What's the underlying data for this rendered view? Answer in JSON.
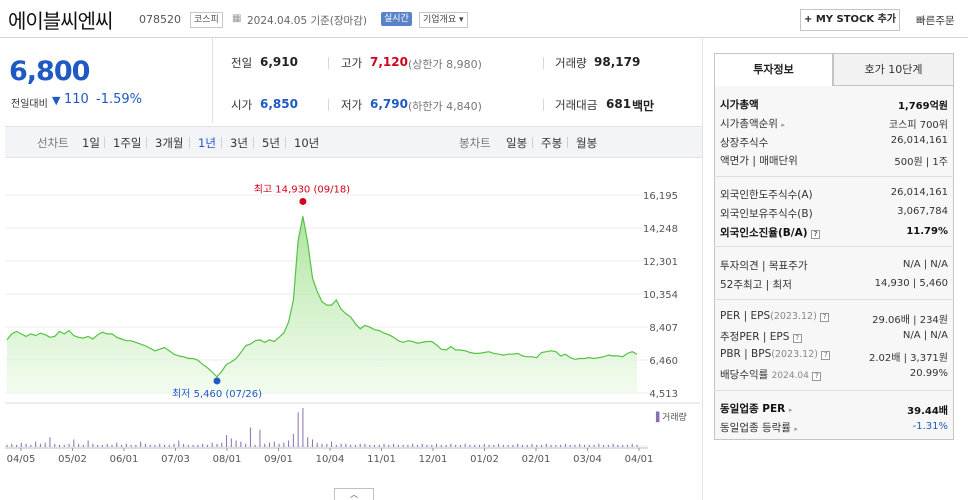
{
  "header": {
    "company": "에이블씨엔씨",
    "code": "078520",
    "market": "코스피",
    "asof": "2024.04.05  기준(장마감)",
    "realtime": "실시간",
    "overview": "기업개요",
    "mystock": "+ MY STOCK 추가",
    "quick_order": "빠른주문"
  },
  "price": {
    "current": "6,800",
    "change_label": "전일대비",
    "change_value": "110",
    "change_pct": "-1.59%",
    "direction": "down"
  },
  "quote": {
    "prev_label": "전일",
    "prev": "6,910",
    "high_label": "고가",
    "high": "7,120",
    "upper_limit": "(상한가 8,980)",
    "volume_label": "거래량",
    "volume": "98,179",
    "open_label": "시가",
    "open": "6,850",
    "low_label": "저가",
    "low": "6,790",
    "lower_limit": "(하한가 4,840)",
    "amount_label": "거래대금",
    "amount": "681",
    "amount_unit": "백만"
  },
  "periods": {
    "line_label": "선차트",
    "line": [
      "1일",
      "1주일",
      "3개월",
      "1년",
      "3년",
      "5년",
      "10년"
    ],
    "selected": "1년",
    "candle_label": "봉차트",
    "candle": [
      "일봉",
      "주봉",
      "월봉"
    ]
  },
  "chart_data": {
    "type": "area",
    "y_ticks": [
      "16,195",
      "14,248",
      "12,301",
      "10,354",
      "8,407",
      "6,460",
      "4,513"
    ],
    "ylim": [
      4513,
      16195
    ],
    "x_ticks": [
      "04/05",
      "05/02",
      "06/01",
      "07/03",
      "08/01",
      "09/01",
      "10/04",
      "11/01",
      "12/01",
      "01/02",
      "02/01",
      "03/04",
      "04/01"
    ],
    "high_label": "최고 14,930 (09/18)",
    "low_label": "최저 5,460 (07/26)",
    "high": 14930,
    "low": 5460,
    "volume_label": "거래량",
    "series": [
      {
        "values": [
          7650,
          8000,
          8150,
          8000,
          7850,
          8000,
          7900,
          8050,
          7950,
          7800,
          7850,
          8150,
          8000,
          8200,
          7900,
          7800,
          7750,
          7850,
          7700,
          7950,
          8100,
          8000,
          8000,
          7800,
          7700,
          7600,
          7600,
          7500,
          7400,
          7300,
          7150,
          7000,
          7100,
          7200,
          7000,
          6800,
          6700,
          6650,
          6550,
          6550,
          6450,
          6200,
          6000,
          5750,
          5460,
          5800,
          6200,
          6350,
          6550,
          6900,
          7300,
          7400,
          7600,
          7650,
          7500,
          7650,
          7550,
          7800,
          8050,
          8700,
          10000,
          13500,
          14930,
          13400,
          11300,
          10500,
          9900,
          9700,
          9700,
          10000,
          9450,
          9200,
          9000,
          8600,
          8300,
          8500,
          8400,
          8250,
          8200,
          8050,
          7950,
          7800,
          7600,
          7500,
          7600,
          7550,
          7450,
          7500,
          7550,
          7550,
          7350,
          7100,
          7050,
          7250,
          7050,
          7050,
          7000,
          6900,
          6850,
          6850,
          6900,
          6950,
          6850,
          6800,
          6750,
          6800,
          6800,
          6850,
          6700,
          6650,
          6650,
          6600,
          6900,
          6950,
          7000,
          6950,
          6700,
          6800,
          6600,
          6500,
          6550,
          6550,
          6600,
          6550,
          6600,
          6650,
          6750,
          6700,
          6700,
          6650,
          6850,
          6950,
          6800
        ]
      }
    ],
    "volume": [
      2,
      3,
      2,
      4,
      3,
      2,
      5,
      3,
      4,
      9,
      3,
      2,
      2,
      3,
      7,
      3,
      2,
      6,
      3,
      2,
      2,
      3,
      2,
      4,
      2,
      3,
      2,
      2,
      5,
      3,
      2,
      2,
      3,
      2,
      2,
      3,
      6,
      3,
      2,
      2,
      2,
      3,
      2,
      4,
      3,
      4,
      11,
      8,
      6,
      5,
      3,
      18,
      2,
      16,
      3,
      4,
      5,
      3,
      4,
      6,
      12,
      32,
      36,
      9,
      7,
      4,
      3,
      3,
      5,
      2,
      3,
      3,
      2,
      2,
      3,
      3,
      2,
      2,
      2,
      3,
      2,
      3,
      2,
      2,
      2,
      3,
      2,
      3,
      2,
      2,
      3,
      2,
      2,
      3,
      2,
      2,
      3,
      2,
      2,
      2,
      3,
      2,
      2,
      3,
      2,
      2,
      2,
      3,
      2,
      2,
      3,
      2,
      2,
      3,
      2,
      2,
      2,
      3,
      2,
      2,
      3,
      2,
      2,
      2,
      3,
      2,
      2,
      3,
      2,
      2,
      2,
      3,
      2
    ]
  },
  "invest": {
    "tab_active": "투자정보",
    "tab_other": "호가 10단계",
    "rows1": [
      {
        "label": "시가총액",
        "value": "1,769억원",
        "bold": true
      },
      {
        "label": "시가총액순위",
        "value": "코스피 700위"
      },
      {
        "label": "상장주식수",
        "value": "26,014,161"
      },
      {
        "label": "액면가 | 매매단위",
        "value": "500원 | 1주"
      }
    ],
    "rows2": [
      {
        "label": "외국인한도주식수(A)",
        "value": "26,014,161"
      },
      {
        "label": "외국인보유주식수(B)",
        "value": "3,067,784"
      },
      {
        "label": "외국인소진율(B/A)",
        "value": "11.79%",
        "bold": true
      }
    ],
    "rows3": [
      {
        "label": "투자의견  |  목표주가",
        "value": "N/A | N/A"
      },
      {
        "label": "52주최고  |  최저",
        "value": "14,930 | 5,460"
      }
    ],
    "rows4": [
      {
        "label": "PER  |  EPS",
        "label_sub": "(2023.12)",
        "value": "29.06배 | 234원"
      },
      {
        "label": "추정PER  |  EPS",
        "value": "N/A | N/A"
      },
      {
        "label": "PBR  |  BPS",
        "label_sub": "(2023.12)",
        "value": "2.02배 | 3,371원"
      },
      {
        "label": "배당수익률",
        "label_sub": "2024.04",
        "value": "20.99%"
      }
    ],
    "rows5": [
      {
        "label": "동일업종 PER",
        "value": "39.44배",
        "bold": true
      },
      {
        "label": "동일업종 등락률",
        "value": "-1.31%",
        "blue": true
      }
    ]
  }
}
